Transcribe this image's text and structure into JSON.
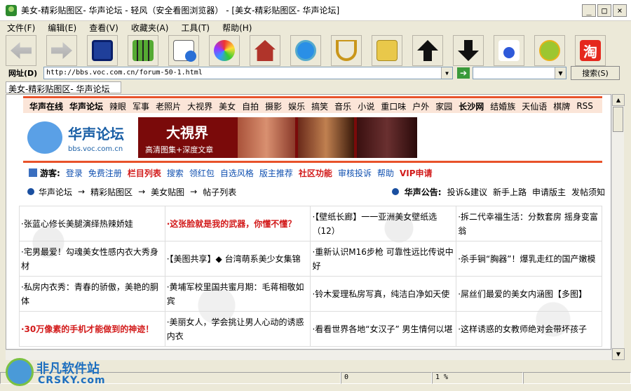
{
  "window": {
    "title": "美女-精彩贴图区- 华声论坛 - 轻风（安全看图浏览器） - [美女-精彩贴图区- 华声论坛]",
    "buttons": {
      "minimize": "_",
      "maximize": "□",
      "close": "×"
    }
  },
  "menu": [
    "文件(F)",
    "编辑(E)",
    "查看(V)",
    "收藏夹(A)",
    "工具(T)",
    "帮助(H)"
  ],
  "toolbar": {
    "icons": [
      "back-arrow-icon",
      "forward-arrow-icon",
      "save-disk-icon",
      "film-strip-icon",
      "page-arrow-icon",
      "color-wheel-icon",
      "house-icon",
      "ie-logo-icon",
      "anchor-icon",
      "folder-doc-icon",
      "up-arrow-icon",
      "down-arrow-icon",
      "baidu-paw-icon",
      "plus-green-icon",
      "taobao-icon"
    ]
  },
  "address": {
    "label": "网址(D)",
    "url": "http://bbs.voc.com.cn/forum-50-1.html",
    "search_button": "搜索(S)"
  },
  "tab": {
    "label": "美女-精彩贴图区- 华声论坛"
  },
  "site": {
    "nav": [
      "华声在线",
      "华声论坛",
      "辣眼",
      "军事",
      "老照片",
      "大视界",
      "美女",
      "自拍",
      "摄影",
      "娱乐",
      "搞笑",
      "音乐",
      "小说",
      "重口味",
      "户外",
      "家园",
      "长沙网",
      "结婚族",
      "天仙语",
      "棋牌",
      "RSS"
    ],
    "logo_name": "华声论坛",
    "logo_url": "bbs.voc.com.cn",
    "banner_title": "大視界",
    "banner_sub": "高清图集+深度文章",
    "userbar": [
      "游客:",
      "登录",
      "免费注册",
      "栏目列表",
      "搜索",
      "领红包",
      "自选风格",
      "版主推荐",
      "社区功能",
      "审核投诉",
      "帮助",
      "VIP申请"
    ],
    "breadcrumbs": [
      "华声论坛",
      "→",
      "精彩贴图区",
      "→",
      "美女贴图",
      "→",
      "帖子列表"
    ],
    "announce": [
      "华声公告:",
      "投诉&建议",
      "新手上路",
      "申请版主",
      "发帖须知"
    ],
    "posts": [
      [
        "·张蓝心修长美腿演绎热辣娇娃",
        "·这张脸就是我的武器，你懂不懂？",
        "·【壁纸长廊】一一亚洲美女壁纸选（12）",
        "·拆二代幸福生活：分数套房 摇身变富翁"
      ],
      [
        "·宅男最爱！勾魂美女性感内衣大秀身材",
        "·【美图共享】◆ 台湾萌系美少女集锦",
        "·重新认识M16步枪 可靠性远比传说中好",
        "·杀手锏“胸器”！爆乳走红的国产嫩模"
      ],
      [
        "·私房内衣秀：青春的骄傲，美艳的胴体",
        "·黄埔军校里国共蜜月期：毛蒋相敬如宾",
        "·铃木爱理私房写真，纯洁白净如天使",
        "·屌丝们最爱的美女内涵图【多图】"
      ],
      [
        "·30万像素的手机才能做到的神迹！",
        "·美丽女人，学会挑让男人心动的诱惑内衣",
        "·看看世界各地“女汉子” 男生情何以堪",
        "·这样诱惑的女教师绝对会带坏孩子"
      ]
    ],
    "hot_cells": [
      "0-1",
      "3-0"
    ]
  },
  "status": {
    "cell1": "0",
    "cell2": "1 %"
  },
  "watermark": {
    "name": "非凡软件站",
    "domain": "CRSKY.com"
  }
}
